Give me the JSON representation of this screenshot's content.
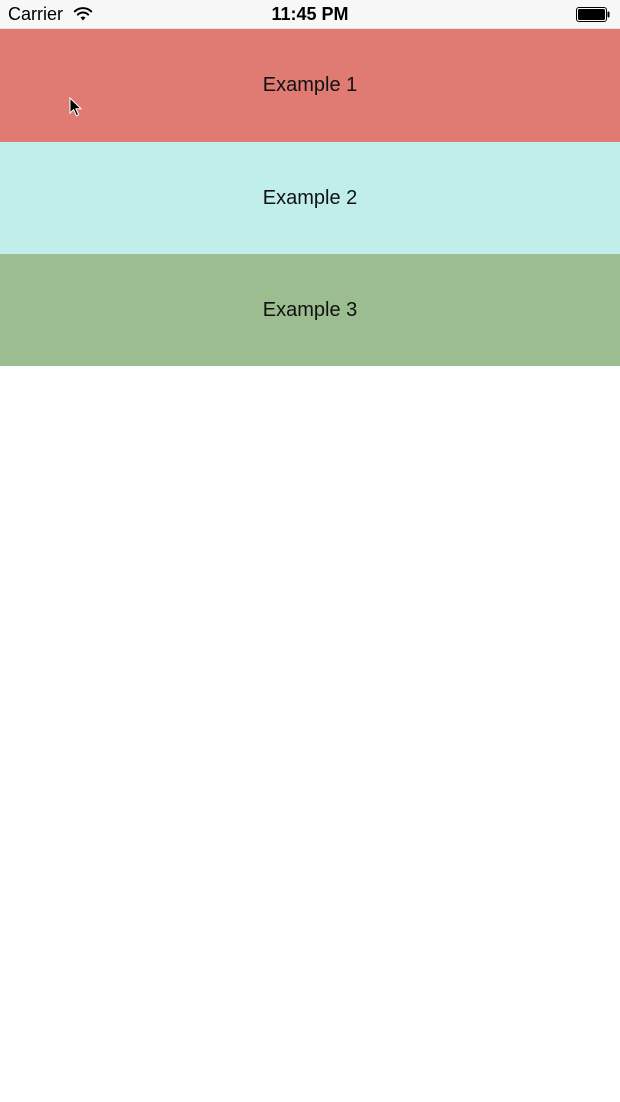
{
  "status_bar": {
    "carrier": "Carrier",
    "time": "11:45 PM",
    "icons": [
      "wifi-icon",
      "battery-icon"
    ]
  },
  "list": {
    "items": [
      {
        "label": "Example 1",
        "color": "#e07b74"
      },
      {
        "label": "Example 2",
        "color": "#c0efeb"
      },
      {
        "label": "Example 3",
        "color": "#9bbd8f"
      }
    ]
  },
  "overlay": {
    "cursor_icon": "cursor-arrow-icon"
  }
}
